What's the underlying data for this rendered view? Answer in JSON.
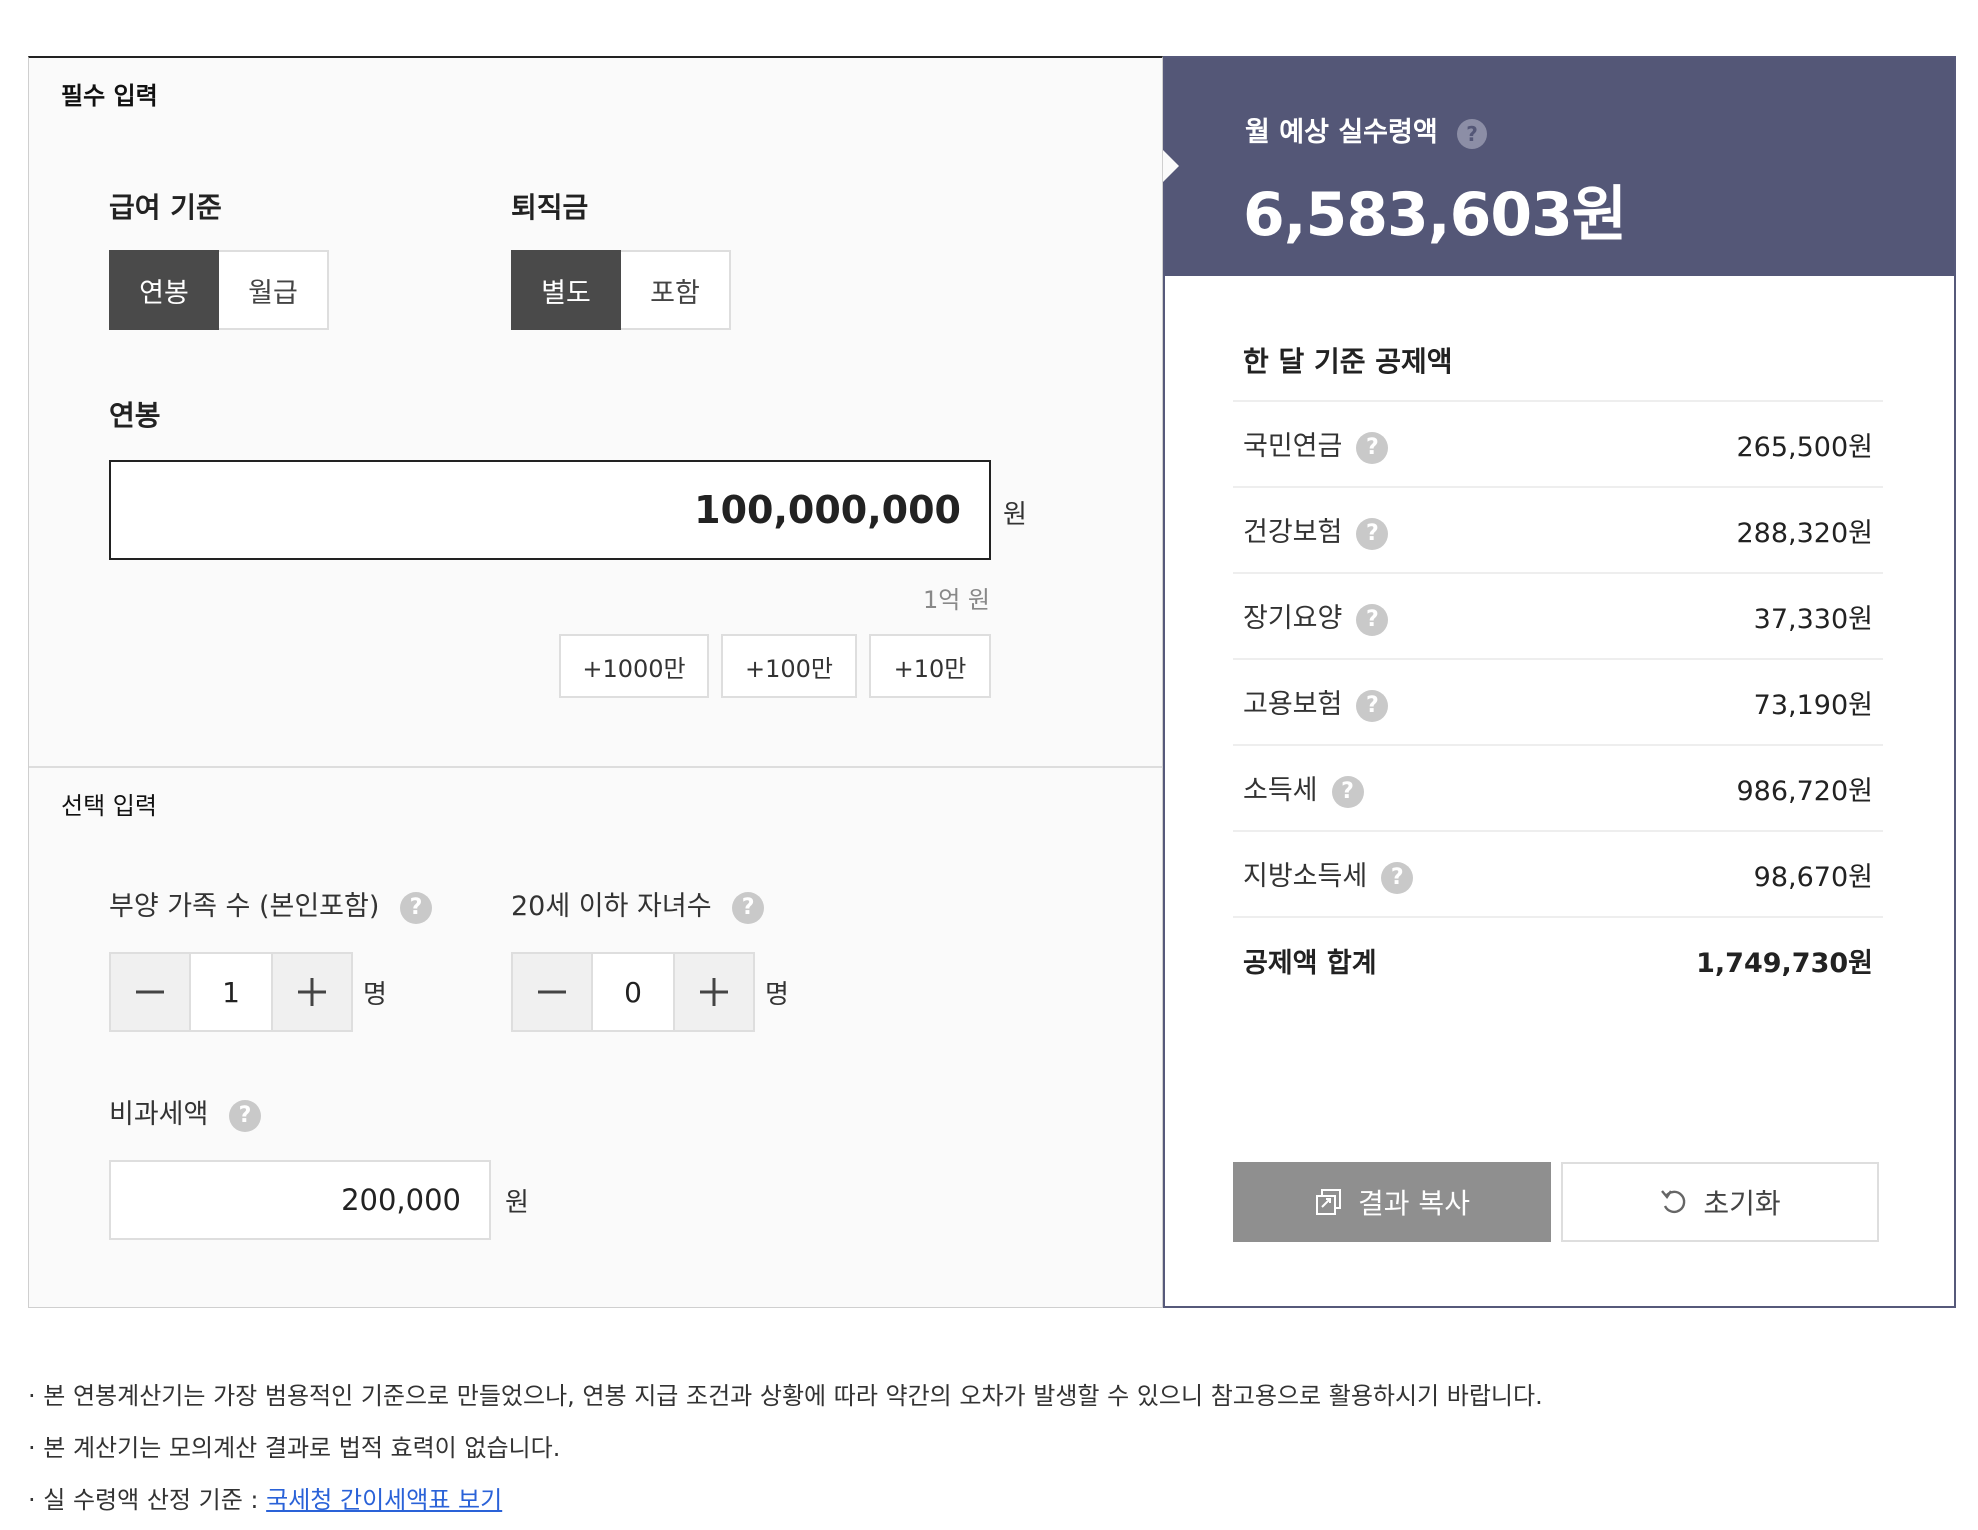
{
  "required": {
    "title": "필수 입력",
    "pay_basis": {
      "label": "급여 기준",
      "options": [
        "연봉",
        "월급"
      ],
      "selected": "연봉"
    },
    "severance": {
      "label": "퇴직금",
      "options": [
        "별도",
        "포함"
      ],
      "selected": "별도"
    },
    "salary": {
      "label": "연봉",
      "value": "100,000,000",
      "unit": "원",
      "hint": "1억 원"
    },
    "quick_add": [
      "+1000만",
      "+100만",
      "+10만"
    ]
  },
  "optional": {
    "title": "선택 입력",
    "dependents": {
      "label": "부양 가족 수 (본인포함)",
      "value": "1",
      "unit": "명"
    },
    "children": {
      "label": "20세 이하 자녀수",
      "value": "0",
      "unit": "명"
    },
    "nontax": {
      "label": "비과세액",
      "value": "200,000",
      "unit": "원"
    }
  },
  "result": {
    "title": "월 예상 실수령액",
    "amount": "6,583,603원",
    "deduction_title": "한 달 기준 공제액",
    "deductions": [
      {
        "name": "국민연금",
        "value": "265,500원"
      },
      {
        "name": "건강보험",
        "value": "288,320원"
      },
      {
        "name": "장기요양",
        "value": "37,330원"
      },
      {
        "name": "고용보험",
        "value": "73,190원"
      },
      {
        "name": "소득세",
        "value": "986,720원"
      },
      {
        "name": "지방소득세",
        "value": "98,670원"
      }
    ],
    "total": {
      "name": "공제액 합계",
      "value": "1,749,730원"
    },
    "copy_label": "결과 복사",
    "reset_label": "초기화"
  },
  "notes": {
    "line1": "· 본 연봉계산기는 가장 범용적인 기준으로 만들었으나, 연봉 지급 조건과 상황에 따라 약간의 오차가 발생할 수 있으니 참고용으로 활용하시기 바랍니다.",
    "line2": "· 본 계산기는 모의계산 결과로 법적 효력이 없습니다.",
    "line3_prefix": "· 실 수령액 산정 기준 : ",
    "line3_link": "국세청 간이세액표 보기"
  },
  "help_glyph": "?",
  "colors": {
    "header_bg": "#545777",
    "active_seg": "#4a4a4a",
    "link": "#2a62d8",
    "copy_btn": "#8f8f8f"
  }
}
